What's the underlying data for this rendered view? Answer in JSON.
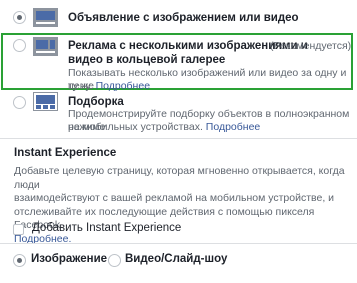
{
  "options": [
    {
      "title": "Объявление с изображением или видео",
      "selected": true
    },
    {
      "title_line1": "Реклама с несколькими изображениями и",
      "title_line2": "видео в кольцевой галерее",
      "recommended": "(Рекомендуется)",
      "desc_line1": "Показывать несколько изображений или видео за одну и ту же",
      "desc_line2": "цену.",
      "link": "Подробнее",
      "selected": false,
      "highlight_color": "#2aa135"
    },
    {
      "title": "Подборка",
      "desc_line1": "Продемонстрируйте подборку объектов в полноэкранном режиме",
      "desc_line2": "на мобильных устройствах.",
      "link": "Подробнее",
      "selected": false
    }
  ],
  "instant_experience": {
    "title": "Instant Experience",
    "desc_line1": "Добавьте целевую страницу, которая мгновенно открывается, когда люди",
    "desc_line2": "взаимодействуют с вашей рекламой на мобильном устройстве, и",
    "desc_line3": "отслеживайте их последующие действия с помощью пикселя Facebook.",
    "link": "Подробнее.",
    "checkbox_label": "Добавить Instant Experience",
    "checked": false
  },
  "media_format": {
    "image_label": "Изображение",
    "video_label": "Видео/Слайд-шоу",
    "selected": "image"
  },
  "colors": {
    "link": "#385898",
    "thumbnail": "#4b6ba7",
    "highlight": "#2aa135"
  }
}
